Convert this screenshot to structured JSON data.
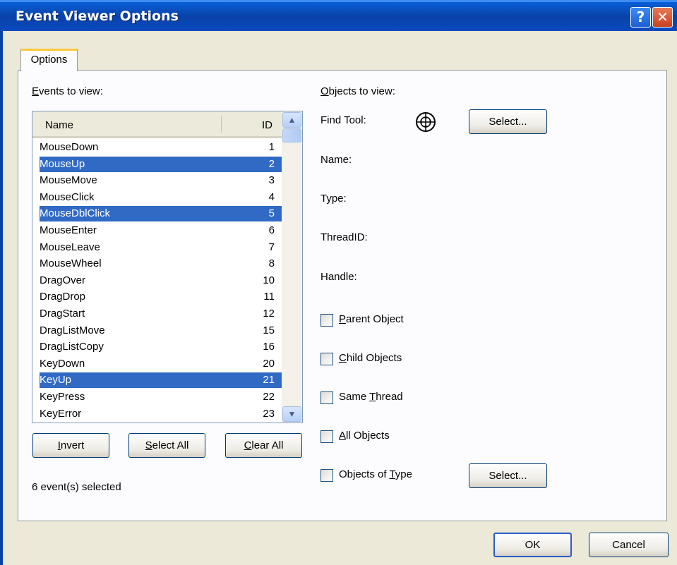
{
  "window": {
    "title": "Event Viewer Options",
    "help_glyph": "?",
    "close_glyph": "✕"
  },
  "tabs": [
    {
      "label": "Options"
    }
  ],
  "events": {
    "label_u": "E",
    "label_rest": "vents to view:",
    "columns": {
      "name": "Name",
      "id": "ID"
    },
    "items": [
      {
        "name": "MouseDown",
        "id": "1",
        "selected": false
      },
      {
        "name": "MouseUp",
        "id": "2",
        "selected": true
      },
      {
        "name": "MouseMove",
        "id": "3",
        "selected": false
      },
      {
        "name": "MouseClick",
        "id": "4",
        "selected": false
      },
      {
        "name": "MouseDblClick",
        "id": "5",
        "selected": true
      },
      {
        "name": "MouseEnter",
        "id": "6",
        "selected": false
      },
      {
        "name": "MouseLeave",
        "id": "7",
        "selected": false
      },
      {
        "name": "MouseWheel",
        "id": "8",
        "selected": false
      },
      {
        "name": "DragOver",
        "id": "10",
        "selected": false
      },
      {
        "name": "DragDrop",
        "id": "11",
        "selected": false
      },
      {
        "name": "DragStart",
        "id": "12",
        "selected": false
      },
      {
        "name": "DragListMove",
        "id": "15",
        "selected": false
      },
      {
        "name": "DragListCopy",
        "id": "16",
        "selected": false
      },
      {
        "name": "KeyDown",
        "id": "20",
        "selected": false
      },
      {
        "name": "KeyUp",
        "id": "21",
        "selected": true
      },
      {
        "name": "KeyPress",
        "id": "22",
        "selected": false
      },
      {
        "name": "KeyError",
        "id": "23",
        "selected": false
      }
    ],
    "invert": {
      "u": "I",
      "rest": "nvert"
    },
    "select_all": {
      "u": "S",
      "rest": "elect All"
    },
    "clear_all": {
      "u": "C",
      "rest": "lear All"
    },
    "status": "6 event(s) selected"
  },
  "objects": {
    "label_u": "O",
    "label_rest": "bjects to view:",
    "find_tool": "Find Tool:",
    "select_button": "Select...",
    "name": "Name:",
    "type": "Type:",
    "thread_id": "ThreadID:",
    "handle": "Handle:",
    "checkboxes": {
      "parent": {
        "u": "P",
        "rest": "arent Object",
        "checked": false
      },
      "child": {
        "u": "C",
        "rest": "hild Objects",
        "checked": false
      },
      "same_thread": {
        "pre": "Same ",
        "u": "T",
        "rest": "hread",
        "checked": false
      },
      "all": {
        "u": "A",
        "rest": "ll Objects",
        "checked": false
      },
      "of_type": {
        "pre": "Objects of ",
        "u": "T",
        "rest": "ype",
        "checked": false
      }
    },
    "type_select_button": "Select..."
  },
  "dialog": {
    "ok": "OK",
    "cancel": "Cancel"
  },
  "icons": {
    "find_tool": "crosshair-icon",
    "scroll_up": "chevron-up-icon",
    "scroll_down": "chevron-down-icon",
    "help": "help-icon",
    "close": "close-icon"
  },
  "colors": {
    "title_bar": "#0842A8",
    "selection": "#316AC5",
    "dialog_bg": "#ECE9D8",
    "tab_accent": "#FFC83C"
  }
}
